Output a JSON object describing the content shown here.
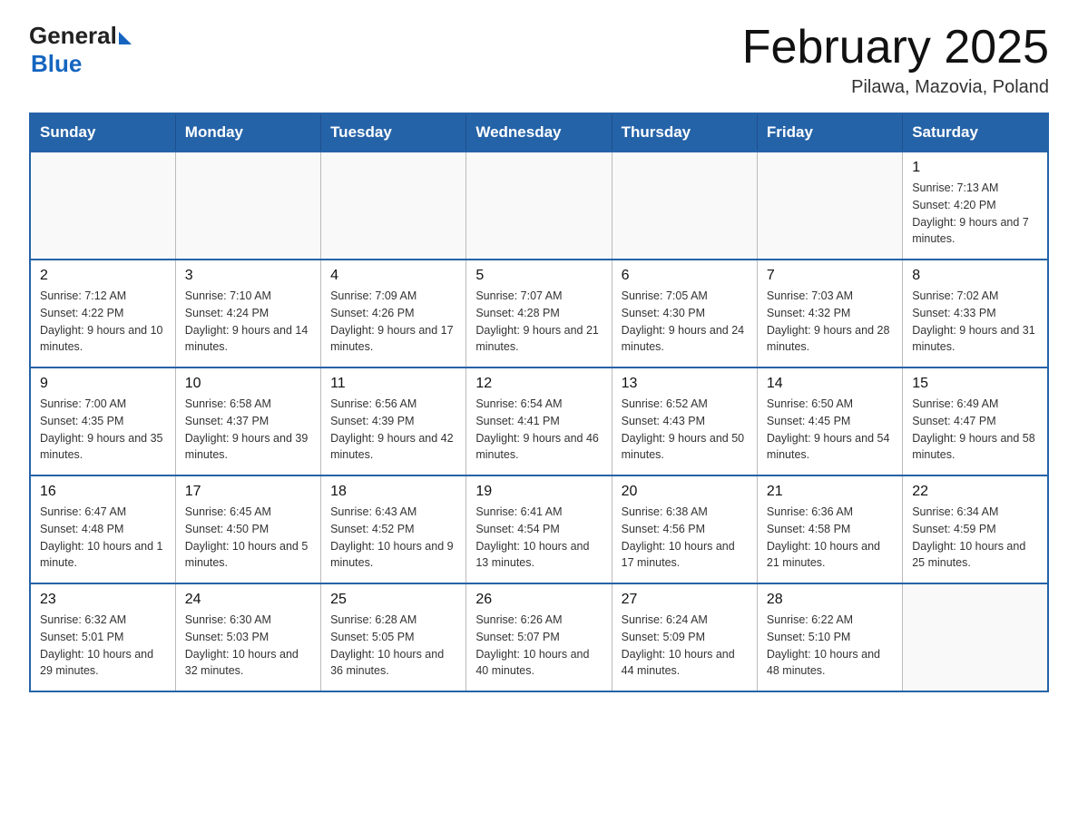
{
  "header": {
    "logo_general": "General",
    "logo_blue": "Blue",
    "month_title": "February 2025",
    "location": "Pilawa, Mazovia, Poland"
  },
  "weekdays": [
    "Sunday",
    "Monday",
    "Tuesday",
    "Wednesday",
    "Thursday",
    "Friday",
    "Saturday"
  ],
  "weeks": [
    [
      {
        "day": "",
        "info": ""
      },
      {
        "day": "",
        "info": ""
      },
      {
        "day": "",
        "info": ""
      },
      {
        "day": "",
        "info": ""
      },
      {
        "day": "",
        "info": ""
      },
      {
        "day": "",
        "info": ""
      },
      {
        "day": "1",
        "info": "Sunrise: 7:13 AM\nSunset: 4:20 PM\nDaylight: 9 hours and 7 minutes."
      }
    ],
    [
      {
        "day": "2",
        "info": "Sunrise: 7:12 AM\nSunset: 4:22 PM\nDaylight: 9 hours and 10 minutes."
      },
      {
        "day": "3",
        "info": "Sunrise: 7:10 AM\nSunset: 4:24 PM\nDaylight: 9 hours and 14 minutes."
      },
      {
        "day": "4",
        "info": "Sunrise: 7:09 AM\nSunset: 4:26 PM\nDaylight: 9 hours and 17 minutes."
      },
      {
        "day": "5",
        "info": "Sunrise: 7:07 AM\nSunset: 4:28 PM\nDaylight: 9 hours and 21 minutes."
      },
      {
        "day": "6",
        "info": "Sunrise: 7:05 AM\nSunset: 4:30 PM\nDaylight: 9 hours and 24 minutes."
      },
      {
        "day": "7",
        "info": "Sunrise: 7:03 AM\nSunset: 4:32 PM\nDaylight: 9 hours and 28 minutes."
      },
      {
        "day": "8",
        "info": "Sunrise: 7:02 AM\nSunset: 4:33 PM\nDaylight: 9 hours and 31 minutes."
      }
    ],
    [
      {
        "day": "9",
        "info": "Sunrise: 7:00 AM\nSunset: 4:35 PM\nDaylight: 9 hours and 35 minutes."
      },
      {
        "day": "10",
        "info": "Sunrise: 6:58 AM\nSunset: 4:37 PM\nDaylight: 9 hours and 39 minutes."
      },
      {
        "day": "11",
        "info": "Sunrise: 6:56 AM\nSunset: 4:39 PM\nDaylight: 9 hours and 42 minutes."
      },
      {
        "day": "12",
        "info": "Sunrise: 6:54 AM\nSunset: 4:41 PM\nDaylight: 9 hours and 46 minutes."
      },
      {
        "day": "13",
        "info": "Sunrise: 6:52 AM\nSunset: 4:43 PM\nDaylight: 9 hours and 50 minutes."
      },
      {
        "day": "14",
        "info": "Sunrise: 6:50 AM\nSunset: 4:45 PM\nDaylight: 9 hours and 54 minutes."
      },
      {
        "day": "15",
        "info": "Sunrise: 6:49 AM\nSunset: 4:47 PM\nDaylight: 9 hours and 58 minutes."
      }
    ],
    [
      {
        "day": "16",
        "info": "Sunrise: 6:47 AM\nSunset: 4:48 PM\nDaylight: 10 hours and 1 minute."
      },
      {
        "day": "17",
        "info": "Sunrise: 6:45 AM\nSunset: 4:50 PM\nDaylight: 10 hours and 5 minutes."
      },
      {
        "day": "18",
        "info": "Sunrise: 6:43 AM\nSunset: 4:52 PM\nDaylight: 10 hours and 9 minutes."
      },
      {
        "day": "19",
        "info": "Sunrise: 6:41 AM\nSunset: 4:54 PM\nDaylight: 10 hours and 13 minutes."
      },
      {
        "day": "20",
        "info": "Sunrise: 6:38 AM\nSunset: 4:56 PM\nDaylight: 10 hours and 17 minutes."
      },
      {
        "day": "21",
        "info": "Sunrise: 6:36 AM\nSunset: 4:58 PM\nDaylight: 10 hours and 21 minutes."
      },
      {
        "day": "22",
        "info": "Sunrise: 6:34 AM\nSunset: 4:59 PM\nDaylight: 10 hours and 25 minutes."
      }
    ],
    [
      {
        "day": "23",
        "info": "Sunrise: 6:32 AM\nSunset: 5:01 PM\nDaylight: 10 hours and 29 minutes."
      },
      {
        "day": "24",
        "info": "Sunrise: 6:30 AM\nSunset: 5:03 PM\nDaylight: 10 hours and 32 minutes."
      },
      {
        "day": "25",
        "info": "Sunrise: 6:28 AM\nSunset: 5:05 PM\nDaylight: 10 hours and 36 minutes."
      },
      {
        "day": "26",
        "info": "Sunrise: 6:26 AM\nSunset: 5:07 PM\nDaylight: 10 hours and 40 minutes."
      },
      {
        "day": "27",
        "info": "Sunrise: 6:24 AM\nSunset: 5:09 PM\nDaylight: 10 hours and 44 minutes."
      },
      {
        "day": "28",
        "info": "Sunrise: 6:22 AM\nSunset: 5:10 PM\nDaylight: 10 hours and 48 minutes."
      },
      {
        "day": "",
        "info": ""
      }
    ]
  ]
}
